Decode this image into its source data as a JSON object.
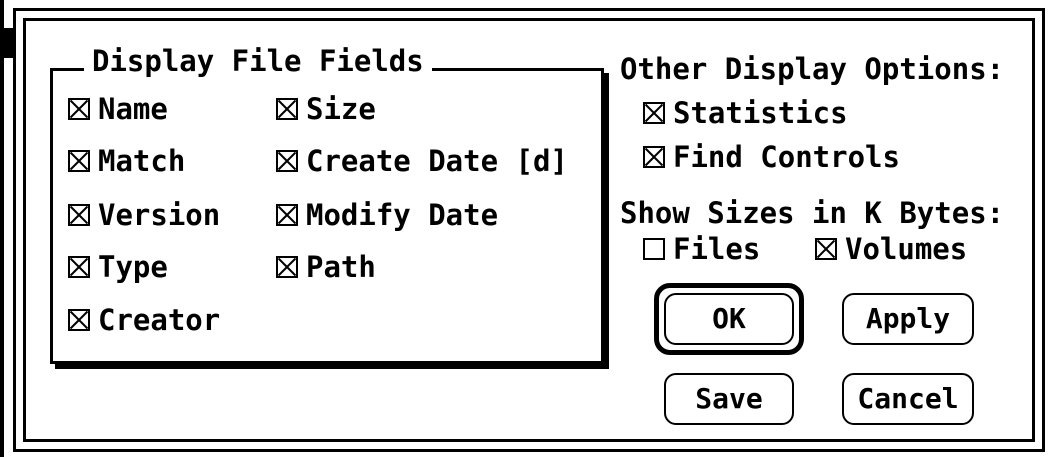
{
  "dialog": {
    "display_fields": {
      "title": "Display File Fields",
      "checkboxes": [
        {
          "label": "Name",
          "checked": true
        },
        {
          "label": "Match",
          "checked": true
        },
        {
          "label": "Version",
          "checked": true
        },
        {
          "label": "Type",
          "checked": true
        },
        {
          "label": "Creator",
          "checked": true
        },
        {
          "label": "Size",
          "checked": true
        },
        {
          "label": "Create Date [d]",
          "checked": true
        },
        {
          "label": "Modify Date",
          "checked": true
        },
        {
          "label": "Path",
          "checked": true
        }
      ]
    },
    "other_options": {
      "title": "Other Display Options:",
      "checkboxes": [
        {
          "label": "Statistics",
          "checked": true
        },
        {
          "label": "Find Controls",
          "checked": true
        }
      ]
    },
    "k_bytes": {
      "title": "Show Sizes in K Bytes:",
      "checkboxes": [
        {
          "label": "Files",
          "checked": false
        },
        {
          "label": "Volumes",
          "checked": true
        }
      ]
    },
    "buttons": {
      "ok": "OK",
      "apply": "Apply",
      "save": "Save",
      "cancel": "Cancel"
    }
  }
}
